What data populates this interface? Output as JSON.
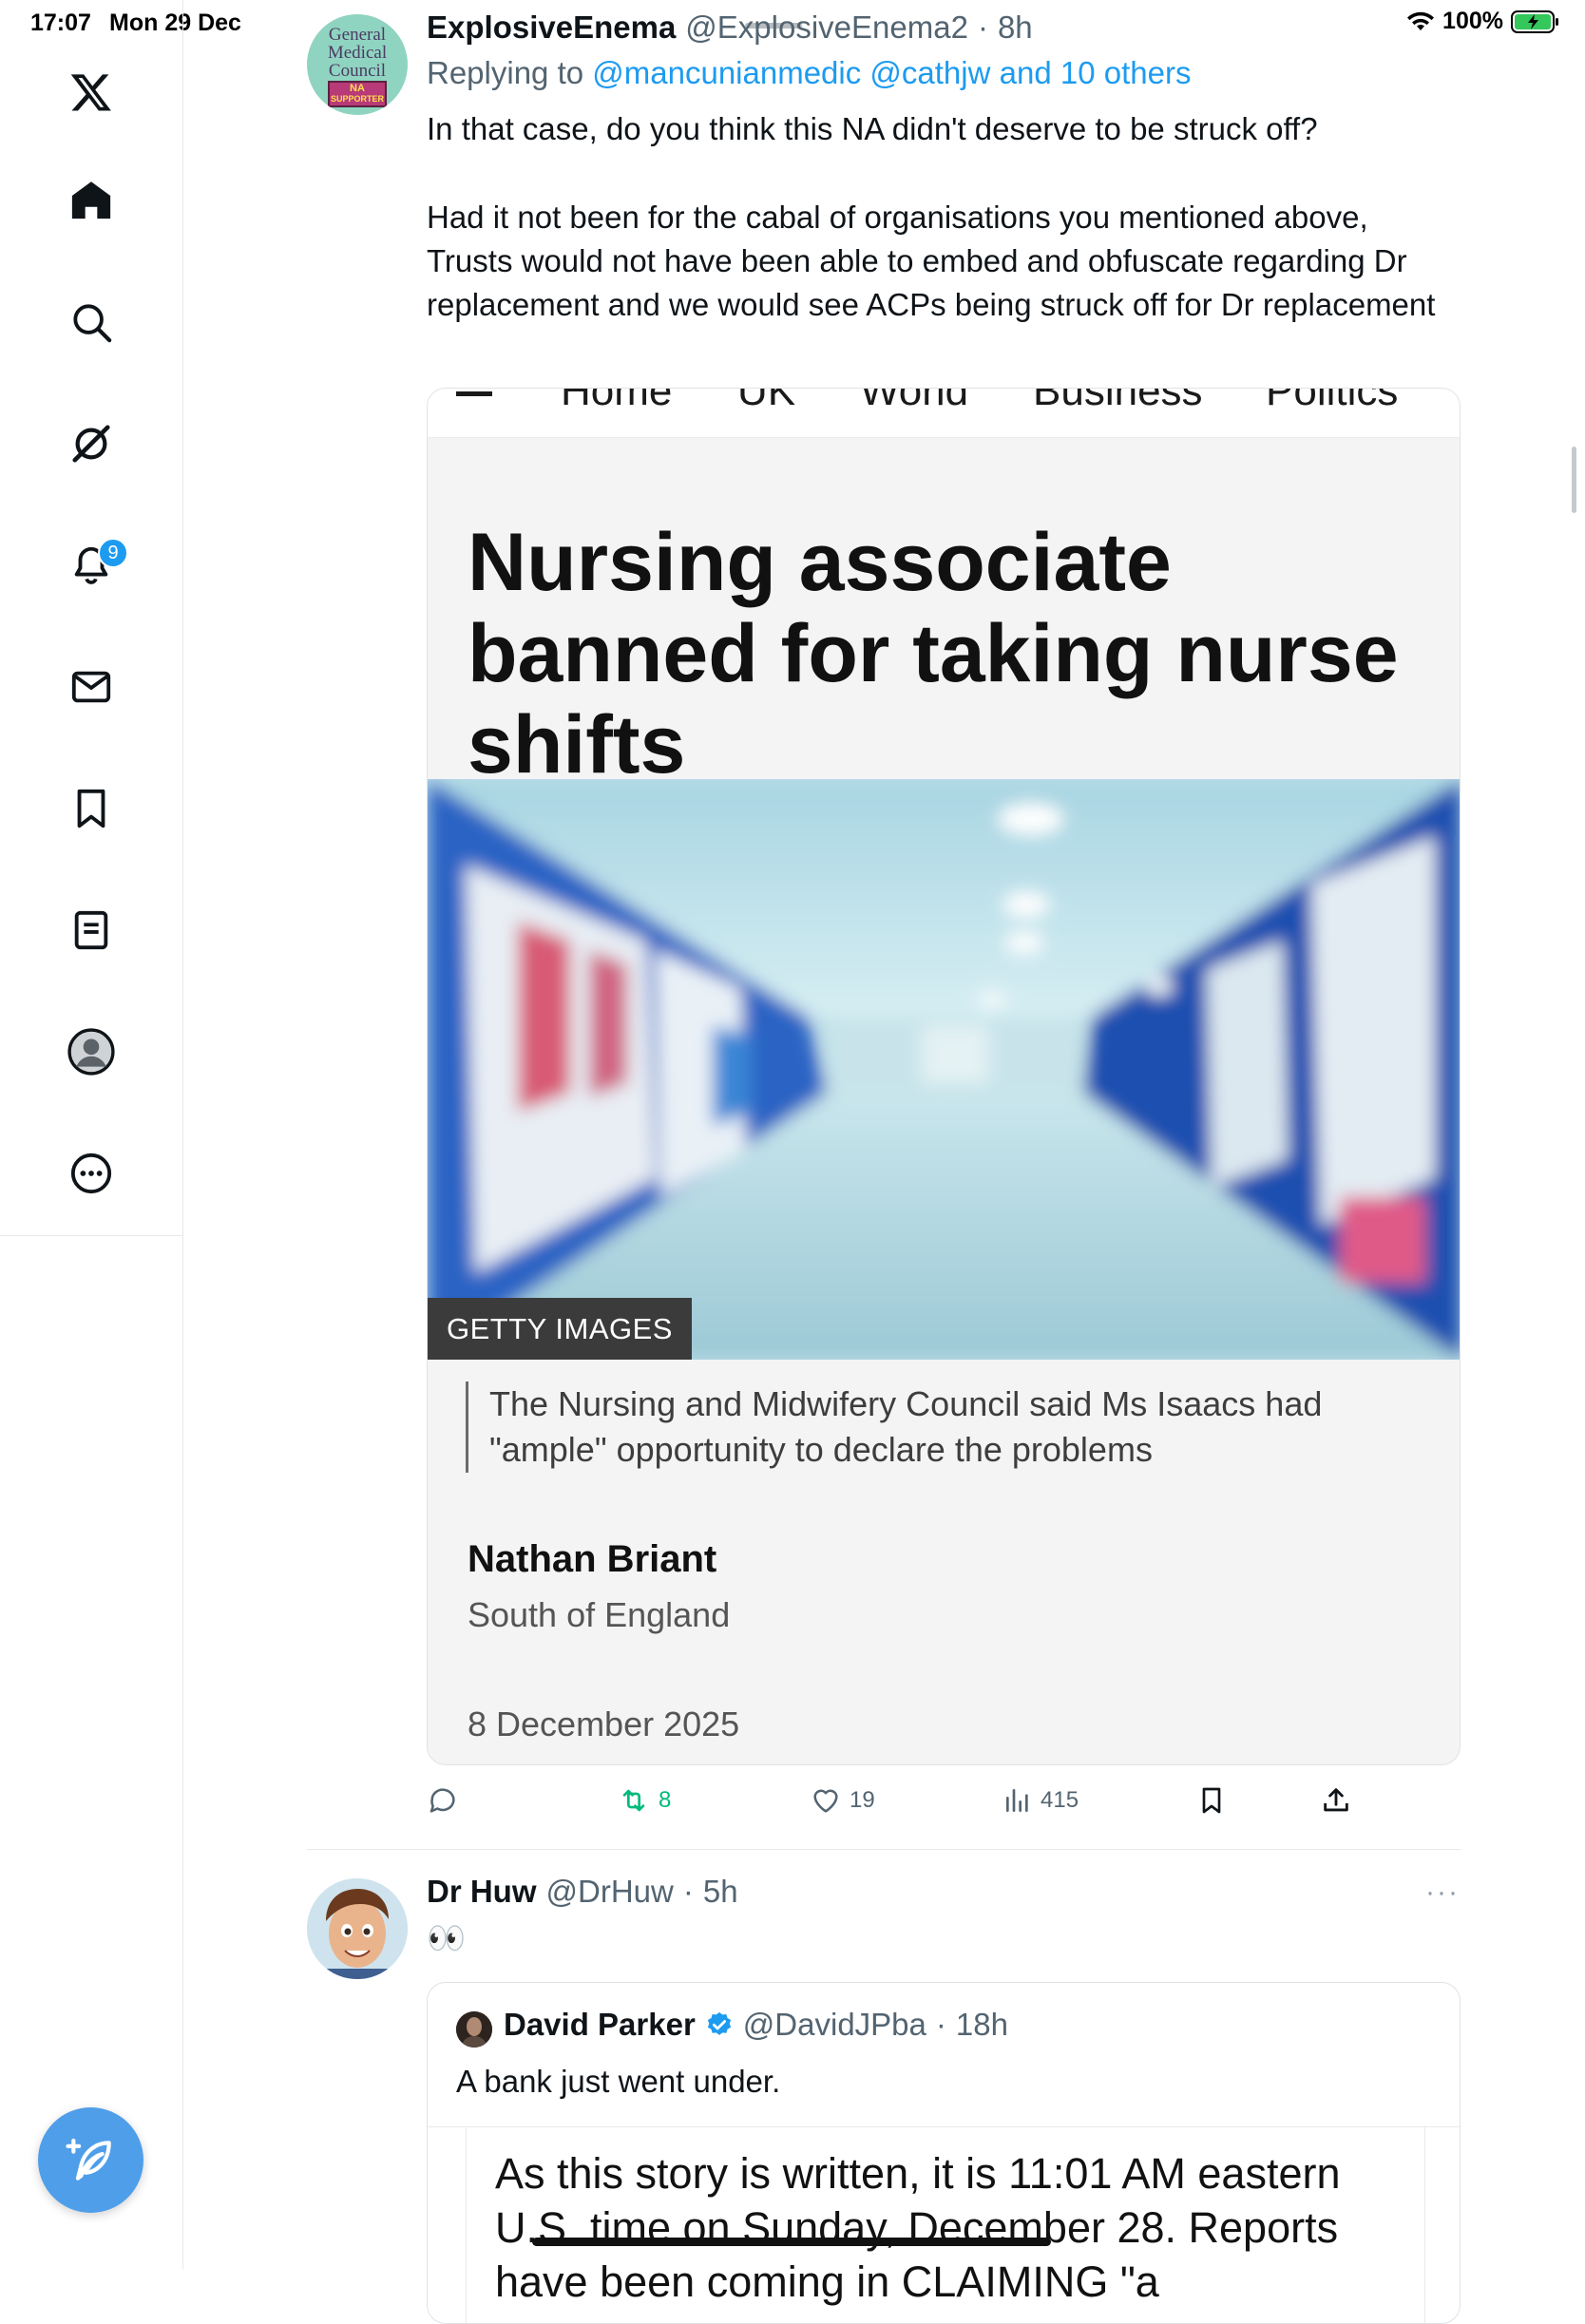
{
  "status_bar": {
    "time": "17:07",
    "date": "Mon 29 Dec",
    "battery": "100%"
  },
  "sidebar": {
    "notifications_badge": "9",
    "icons": [
      "x-logo-icon",
      "home-icon",
      "search-icon",
      "grok-icon",
      "notifications-icon",
      "messages-icon",
      "bookmarks-icon",
      "lists-icon",
      "profile-icon",
      "more-icon"
    ]
  },
  "tweet1": {
    "avatar_text": [
      "General",
      "Medical",
      "Council",
      "NA",
      "SUPPORTER"
    ],
    "display_name": "ExplosiveEnema",
    "handle": "@ExplosiveEnema2",
    "time": "8h",
    "replying_prefix": "Replying to",
    "replying_users": "@mancunianmedic @cathjw and 10 others",
    "text_line1": "In that case, do you think this NA didn't deserve to be struck off?",
    "text_para2": "Had it not been for the cabal of organisations you mentioned above, Trusts would not have been able to embed and obfuscate regarding Dr replacement and we would see ACPs being struck off for Dr replacement",
    "card": {
      "nav_items": [
        "Home",
        "UK",
        "World",
        "Business",
        "Politics"
      ],
      "headline": "Nursing associate banned for taking nurse shifts",
      "image_credit": "GETTY IMAGES",
      "caption": "The Nursing and Midwifery Council said Ms Isaacs had \"ample\" opportunity to declare the problems",
      "author": "Nathan Briant",
      "region": "South of England",
      "date": "8 December 2025"
    },
    "actions": {
      "replies": "",
      "reposts": "8",
      "likes": "19",
      "views": "415"
    },
    "colors": {
      "repost": "#00ba7c",
      "link": "#1d9bf0"
    }
  },
  "tweet2": {
    "display_name": "Dr Huw",
    "handle": "@DrHuw",
    "time": "5h",
    "text": "👀",
    "more": "···",
    "quote": {
      "display_name": "David Parker",
      "handle": "@DavidJPba",
      "time": "18h",
      "text": "A bank just went under.",
      "doc_text": "As this story is written, it is 11:01 AM eastern U.S. time on Sunday, December 28.  Reports have been coming in CLAIMING \"a"
    }
  }
}
